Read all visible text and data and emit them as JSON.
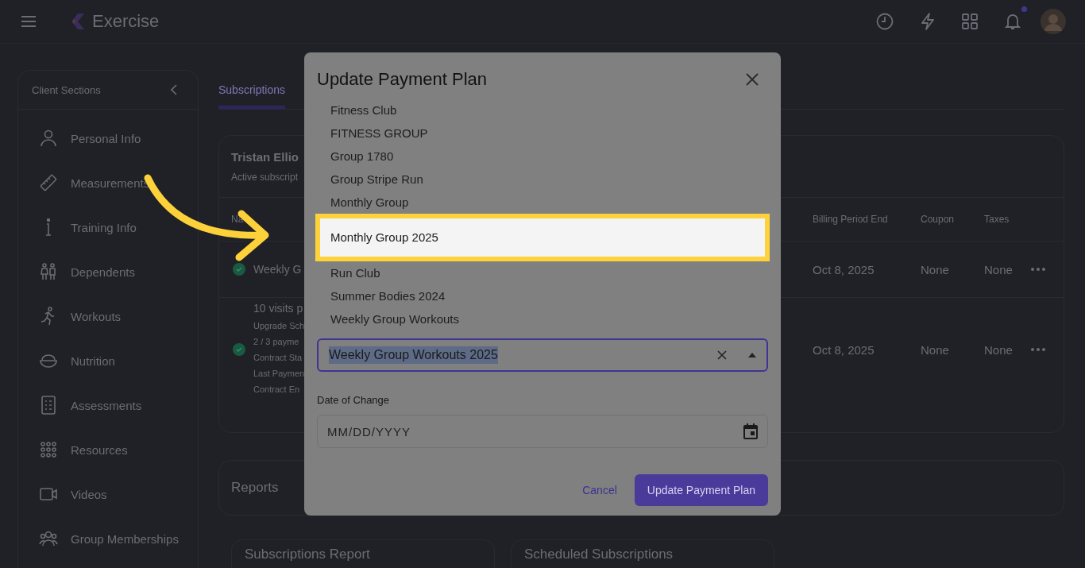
{
  "app": {
    "title": "Exercise",
    "notification_dot": true
  },
  "sidebar": {
    "title": "Client Sections",
    "items": [
      {
        "label": "Personal Info",
        "kind": "person"
      },
      {
        "label": "Measurements",
        "kind": "ruler"
      },
      {
        "label": "Training Info",
        "kind": "info"
      },
      {
        "label": "Dependents",
        "kind": "family"
      },
      {
        "label": "Workouts",
        "kind": "runner"
      },
      {
        "label": "Nutrition",
        "kind": "bowl"
      },
      {
        "label": "Assessments",
        "kind": "checklist"
      },
      {
        "label": "Resources",
        "kind": "grid"
      },
      {
        "label": "Videos",
        "kind": "video"
      },
      {
        "label": "Group Memberships",
        "kind": "group"
      }
    ]
  },
  "tabs": [
    {
      "label": "Subscriptions",
      "selected": true
    }
  ],
  "client": {
    "name": "Tristan Ellio",
    "subtitle": "Active subscript"
  },
  "subscriptions": {
    "columns": [
      "Na",
      "Billing Period End",
      "Coupon",
      "Taxes"
    ],
    "rows": [
      {
        "active": true,
        "name": "Weekly G",
        "details": [],
        "billing_period_end": "Oct 8, 2025",
        "coupon": "None",
        "taxes": "None"
      },
      {
        "active": true,
        "name": "10 visits p",
        "details": [
          "Upgrade Sch",
          "2 / 3 payme",
          "Contract Sta",
          "Last Paymen",
          "Contract En"
        ],
        "billing_period_end": "Oct 8, 2025",
        "coupon": "None",
        "taxes": "None"
      }
    ]
  },
  "reports": {
    "title": "Reports",
    "cards": [
      "Subscriptions Report",
      "Scheduled Subscriptions"
    ]
  },
  "dialog": {
    "title": "Update Payment Plan",
    "options": [
      {
        "label": "Fitness Club",
        "selected": false
      },
      {
        "label": "FITNESS GROUP",
        "selected": false
      },
      {
        "label": "Group 1780",
        "selected": false
      },
      {
        "label": "Group Stripe Run",
        "selected": false
      },
      {
        "label": "Monthly Group",
        "selected": false
      },
      {
        "label": "Monthly Group 2025",
        "selected": true
      },
      {
        "label": "Run Club",
        "selected": false
      },
      {
        "label": "Summer Bodies 2024",
        "selected": false
      },
      {
        "label": "Weekly Group Workouts",
        "selected": false
      }
    ],
    "plan_field": {
      "value": "Weekly Group Workouts 2025",
      "value_highlighted": true
    },
    "date_label": "Date of Change",
    "date_field": {
      "placeholder": "MM/DD/YYYY"
    },
    "buttons": [
      {
        "label": "Cancel",
        "kind": "text"
      },
      {
        "label": "Update Payment Plan",
        "kind": "primary"
      }
    ]
  }
}
